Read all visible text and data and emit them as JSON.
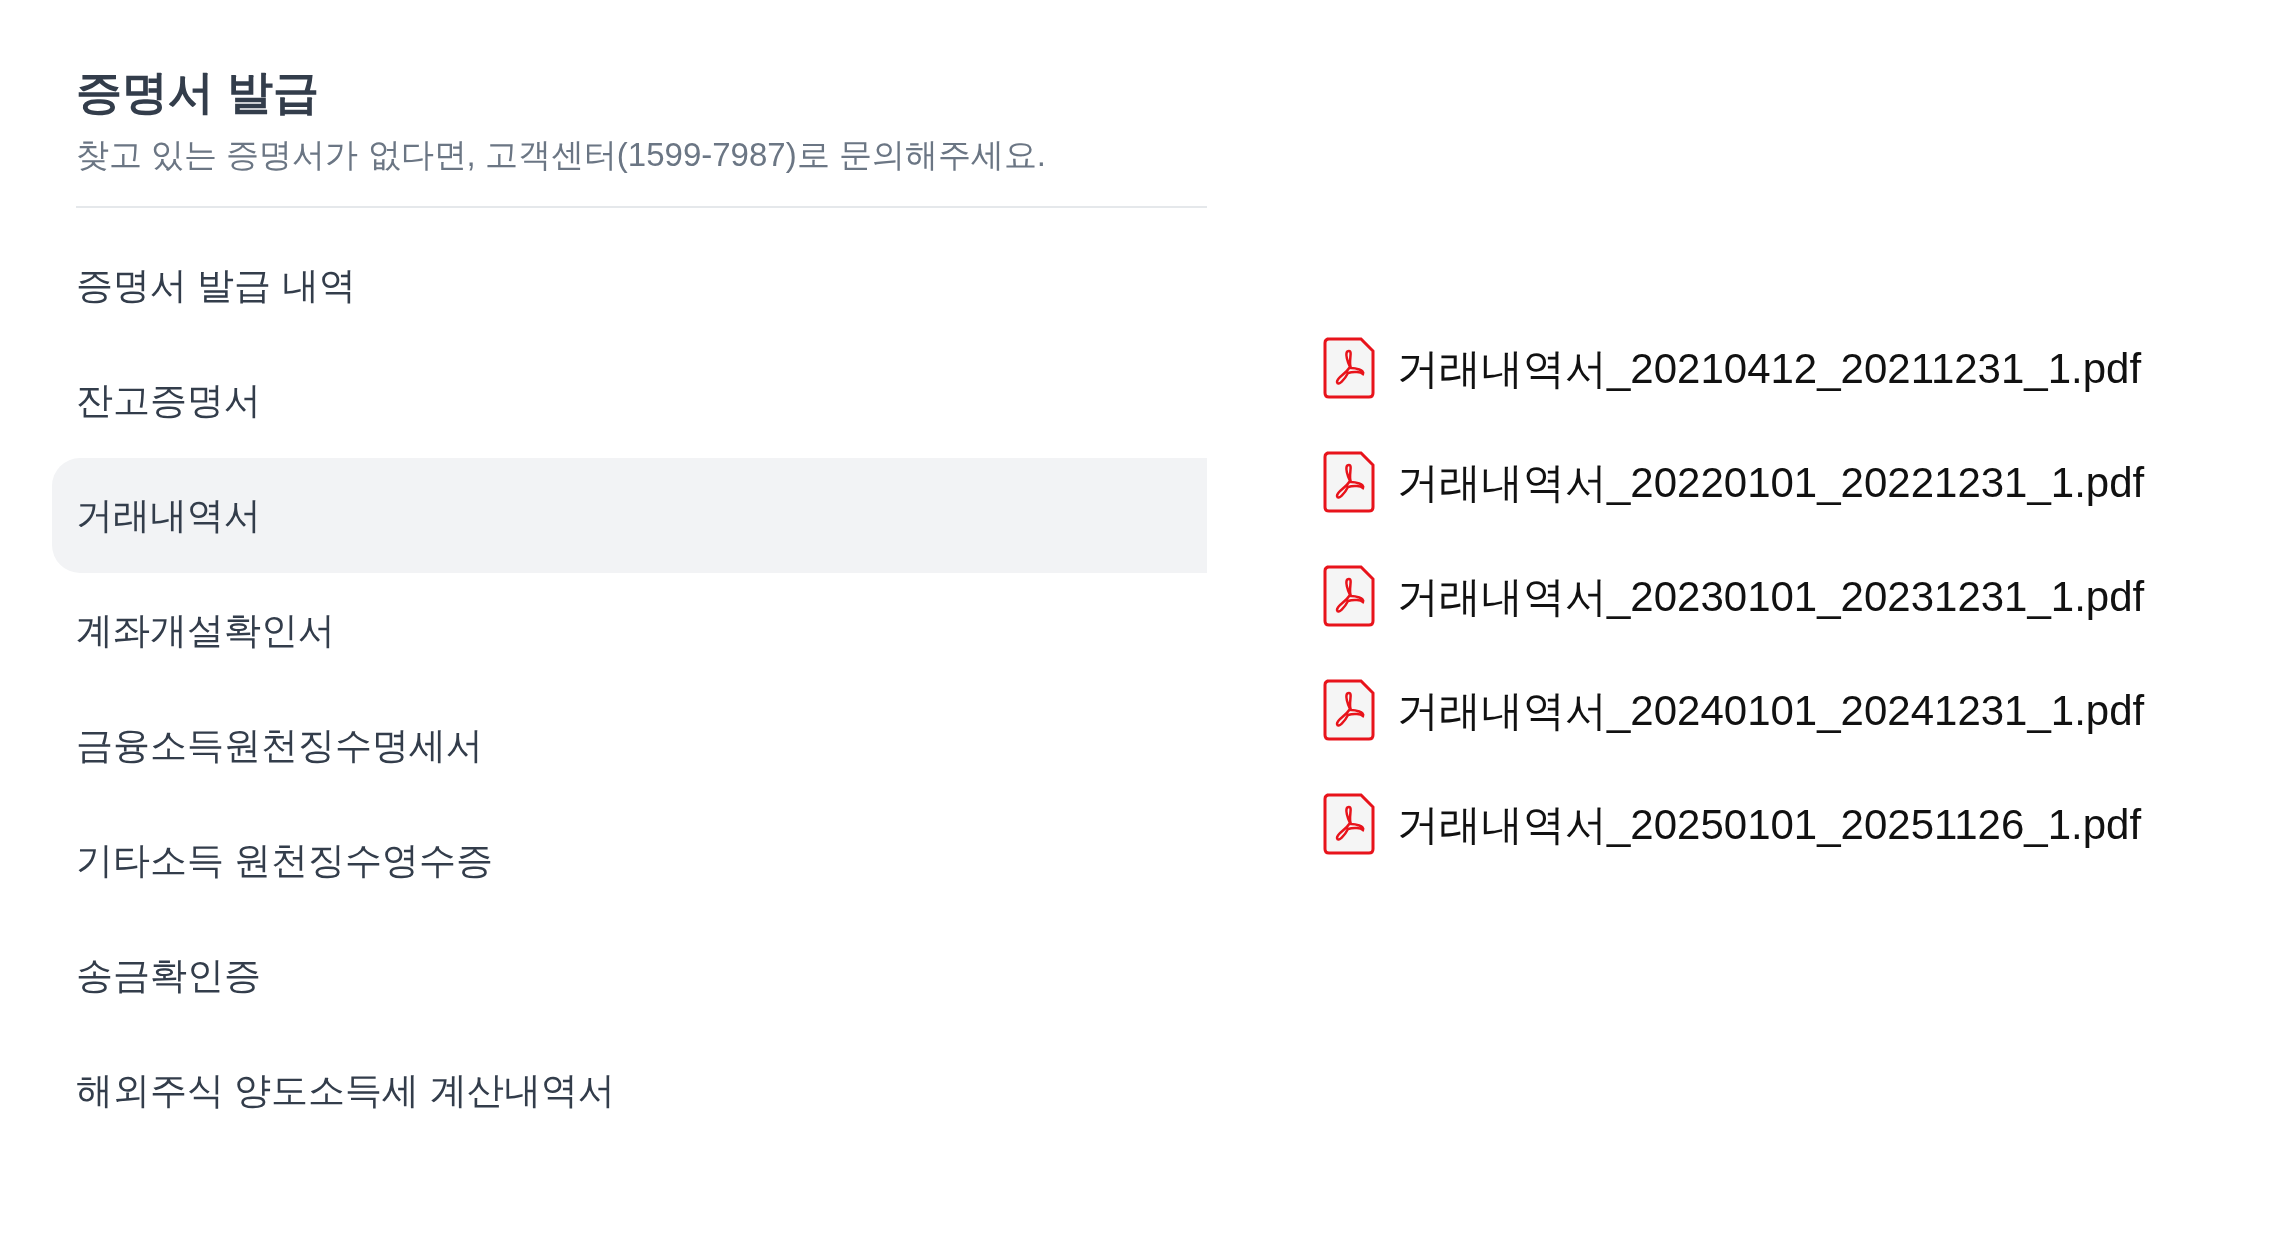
{
  "header": {
    "title": "증명서 발급",
    "subtitle": "찾고 있는 증명서가 없다면, 고객센터(1599-7987)로 문의해주세요."
  },
  "menu": [
    {
      "label": "증명서 발급 내역",
      "selected": false
    },
    {
      "label": "잔고증명서",
      "selected": false
    },
    {
      "label": "거래내역서",
      "selected": true
    },
    {
      "label": "계좌개설확인서",
      "selected": false
    },
    {
      "label": "금융소득원천징수명세서",
      "selected": false
    },
    {
      "label": "기타소득 원천징수영수증",
      "selected": false
    },
    {
      "label": "송금확인증",
      "selected": false
    },
    {
      "label": "해외주식 양도소득세 계산내역서",
      "selected": false
    }
  ],
  "files": [
    {
      "name": "거래내역서_20210412_20211231_1.pdf"
    },
    {
      "name": "거래내역서_20220101_20221231_1.pdf"
    },
    {
      "name": "거래내역서_20230101_20231231_1.pdf"
    },
    {
      "name": "거래내역서_20240101_20241231_1.pdf"
    },
    {
      "name": "거래내역서_20250101_20251126_1.pdf"
    }
  ]
}
